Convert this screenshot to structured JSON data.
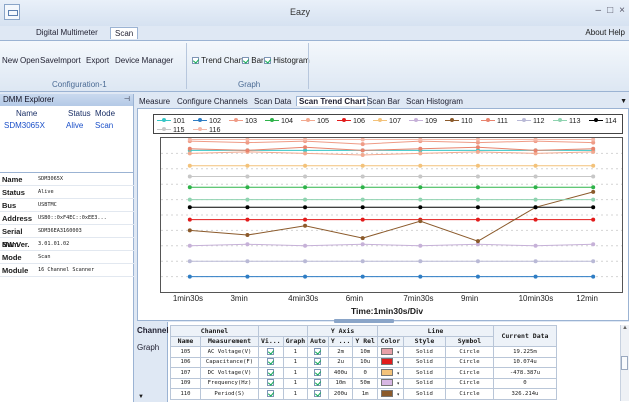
{
  "window": {
    "title": "Eazy"
  },
  "ribbon_tabs": [
    {
      "label": "Digital Multimeter"
    },
    {
      "label": "Scan"
    }
  ],
  "about_label": "About Help",
  "config_buttons": [
    {
      "label": "New"
    },
    {
      "label": "Open"
    },
    {
      "label": "Save"
    },
    {
      "label": "Import"
    },
    {
      "label": "Export"
    },
    {
      "label": "Device Manager"
    }
  ],
  "config_group_label": "Configuration-1",
  "graph_options": [
    {
      "label": "Trend Chart",
      "checked": true
    },
    {
      "label": "Bar",
      "checked": true
    },
    {
      "label": "Histogram",
      "checked": true
    }
  ],
  "graph_group_label": "Graph",
  "explorer": {
    "title": "DMM Explorer",
    "columns": {
      "name": "Name",
      "status": "Status",
      "mode": "Mode"
    },
    "device": {
      "name": "SDM3065X",
      "status": "Alive",
      "mode": "Scan"
    }
  },
  "properties": [
    {
      "key": "Name",
      "value": "SDM3065X"
    },
    {
      "key": "Status",
      "value": "Alive"
    },
    {
      "key": "Bus",
      "value": "USBTMC"
    },
    {
      "key": "Address",
      "value": "USB0::0xF4EC::0xEE3..."
    },
    {
      "key": "Serial Num",
      "value": "SDM36EA3160003"
    },
    {
      "key": "SW Ver.",
      "value": "3.01.01.02"
    },
    {
      "key": "Mode",
      "value": "Scan"
    },
    {
      "key": "Module",
      "value": "16 Channel Scanner"
    }
  ],
  "main_tabs": [
    {
      "label": "Measure"
    },
    {
      "label": "Configure Channels"
    },
    {
      "label": "Scan Data"
    },
    {
      "label": "Scan Trend Chart",
      "active": true
    },
    {
      "label": "Scan Bar"
    },
    {
      "label": "Scan Histogram"
    }
  ],
  "chart_data": {
    "type": "line",
    "title": "",
    "xlabel": "Time:1min30s/Div",
    "ylabel": "",
    "x_ticks": [
      "1min30s",
      "3min",
      "4min30s",
      "6min",
      "7min30s",
      "9min",
      "10min30s",
      "12min"
    ],
    "grid": true,
    "legend_position": "top",
    "series": [
      {
        "name": "101",
        "color": "#37c6c6",
        "values": [
          92,
          92,
          92,
          92,
          92,
          92,
          92,
          92
        ]
      },
      {
        "name": "102",
        "color": "#2e7dc4",
        "values": [
          10,
          10,
          10,
          10,
          10,
          10,
          10,
          10
        ]
      },
      {
        "name": "103",
        "color": "#ef9b86",
        "values": [
          98,
          97,
          98,
          96,
          98,
          97,
          98,
          97
        ]
      },
      {
        "name": "104",
        "color": "#2fb34a",
        "values": [
          68,
          68,
          68,
          68,
          68,
          68,
          68,
          68
        ]
      },
      {
        "name": "105",
        "color": "#f2a98f",
        "values": [
          90,
          91,
          90,
          89,
          90,
          91,
          90,
          91
        ]
      },
      {
        "name": "106",
        "color": "#e21b1b",
        "values": [
          47,
          47,
          47,
          47,
          47,
          47,
          47,
          47
        ]
      },
      {
        "name": "107",
        "color": "#f3c27a",
        "values": [
          82,
          82,
          82,
          82,
          82,
          82,
          82,
          82
        ]
      },
      {
        "name": "109",
        "color": "#c6b1d8",
        "values": [
          30,
          31,
          30,
          31,
          30,
          31,
          30,
          31
        ]
      },
      {
        "name": "110",
        "color": "#8b5a2b",
        "values": [
          40,
          37,
          43,
          35,
          46,
          33,
          55,
          65
        ]
      },
      {
        "name": "111",
        "color": "#e8836d",
        "values": [
          93,
          92,
          94,
          92,
          93,
          94,
          92,
          93
        ]
      },
      {
        "name": "112",
        "color": "#b9b9d6",
        "values": [
          20,
          20,
          20,
          20,
          20,
          20,
          20,
          20
        ]
      },
      {
        "name": "113",
        "color": "#8fd3b0",
        "values": [
          60,
          60,
          60,
          60,
          60,
          60,
          60,
          60
        ]
      },
      {
        "name": "114",
        "color": "#000000",
        "values": [
          55,
          55,
          55,
          55,
          55,
          55,
          55,
          55
        ]
      },
      {
        "name": "115",
        "color": "#c7c7c7",
        "values": [
          75,
          75,
          75,
          75,
          75,
          75,
          75,
          75
        ]
      },
      {
        "name": "116",
        "color": "#f4b8a8",
        "values": [
          99,
          99,
          99,
          99,
          99,
          99,
          99,
          99
        ]
      }
    ]
  },
  "grid": {
    "side_tabs": [
      {
        "label": "Channel"
      },
      {
        "label": "Graph"
      }
    ],
    "group_headers": {
      "channel": "Channel",
      "y_axis": "Y Axis",
      "line": "Line",
      "current": "Current Data"
    },
    "columns": [
      "Name",
      "Measurement",
      "Vi...",
      "Graph",
      "Auto",
      "Y ...",
      "Y Rel",
      "Color",
      "Style",
      "Symbol"
    ],
    "rows": [
      {
        "name": "105",
        "measurement": "AC Voltage(V)",
        "graph": "1",
        "y": "2m",
        "yrel": "10m",
        "color": "#e8a0a8",
        "style": "Solid",
        "symbol": "Circle",
        "current": "19.225m"
      },
      {
        "name": "106",
        "measurement": "Capacitance(F)",
        "graph": "1",
        "y": "2u",
        "yrel": "10u",
        "color": "#e21b1b",
        "style": "Solid",
        "symbol": "Circle",
        "current": "10.074u"
      },
      {
        "name": "107",
        "measurement": "DC Voltage(V)",
        "graph": "1",
        "y": "400u",
        "yrel": "0",
        "color": "#f3c27a",
        "style": "Solid",
        "symbol": "Circle",
        "current": "-478.387u"
      },
      {
        "name": "109",
        "measurement": "Frequency(Hz)",
        "graph": "1",
        "y": "10m",
        "yrel": "50m",
        "color": "#d7b6e3",
        "style": "Solid",
        "symbol": "Circle",
        "current": "0"
      },
      {
        "name": "110",
        "measurement": "Period(S)",
        "graph": "1",
        "y": "200u",
        "yrel": "1m",
        "color": "#8b5a2b",
        "style": "Solid",
        "symbol": "Circle",
        "current": "326.214u"
      }
    ]
  }
}
